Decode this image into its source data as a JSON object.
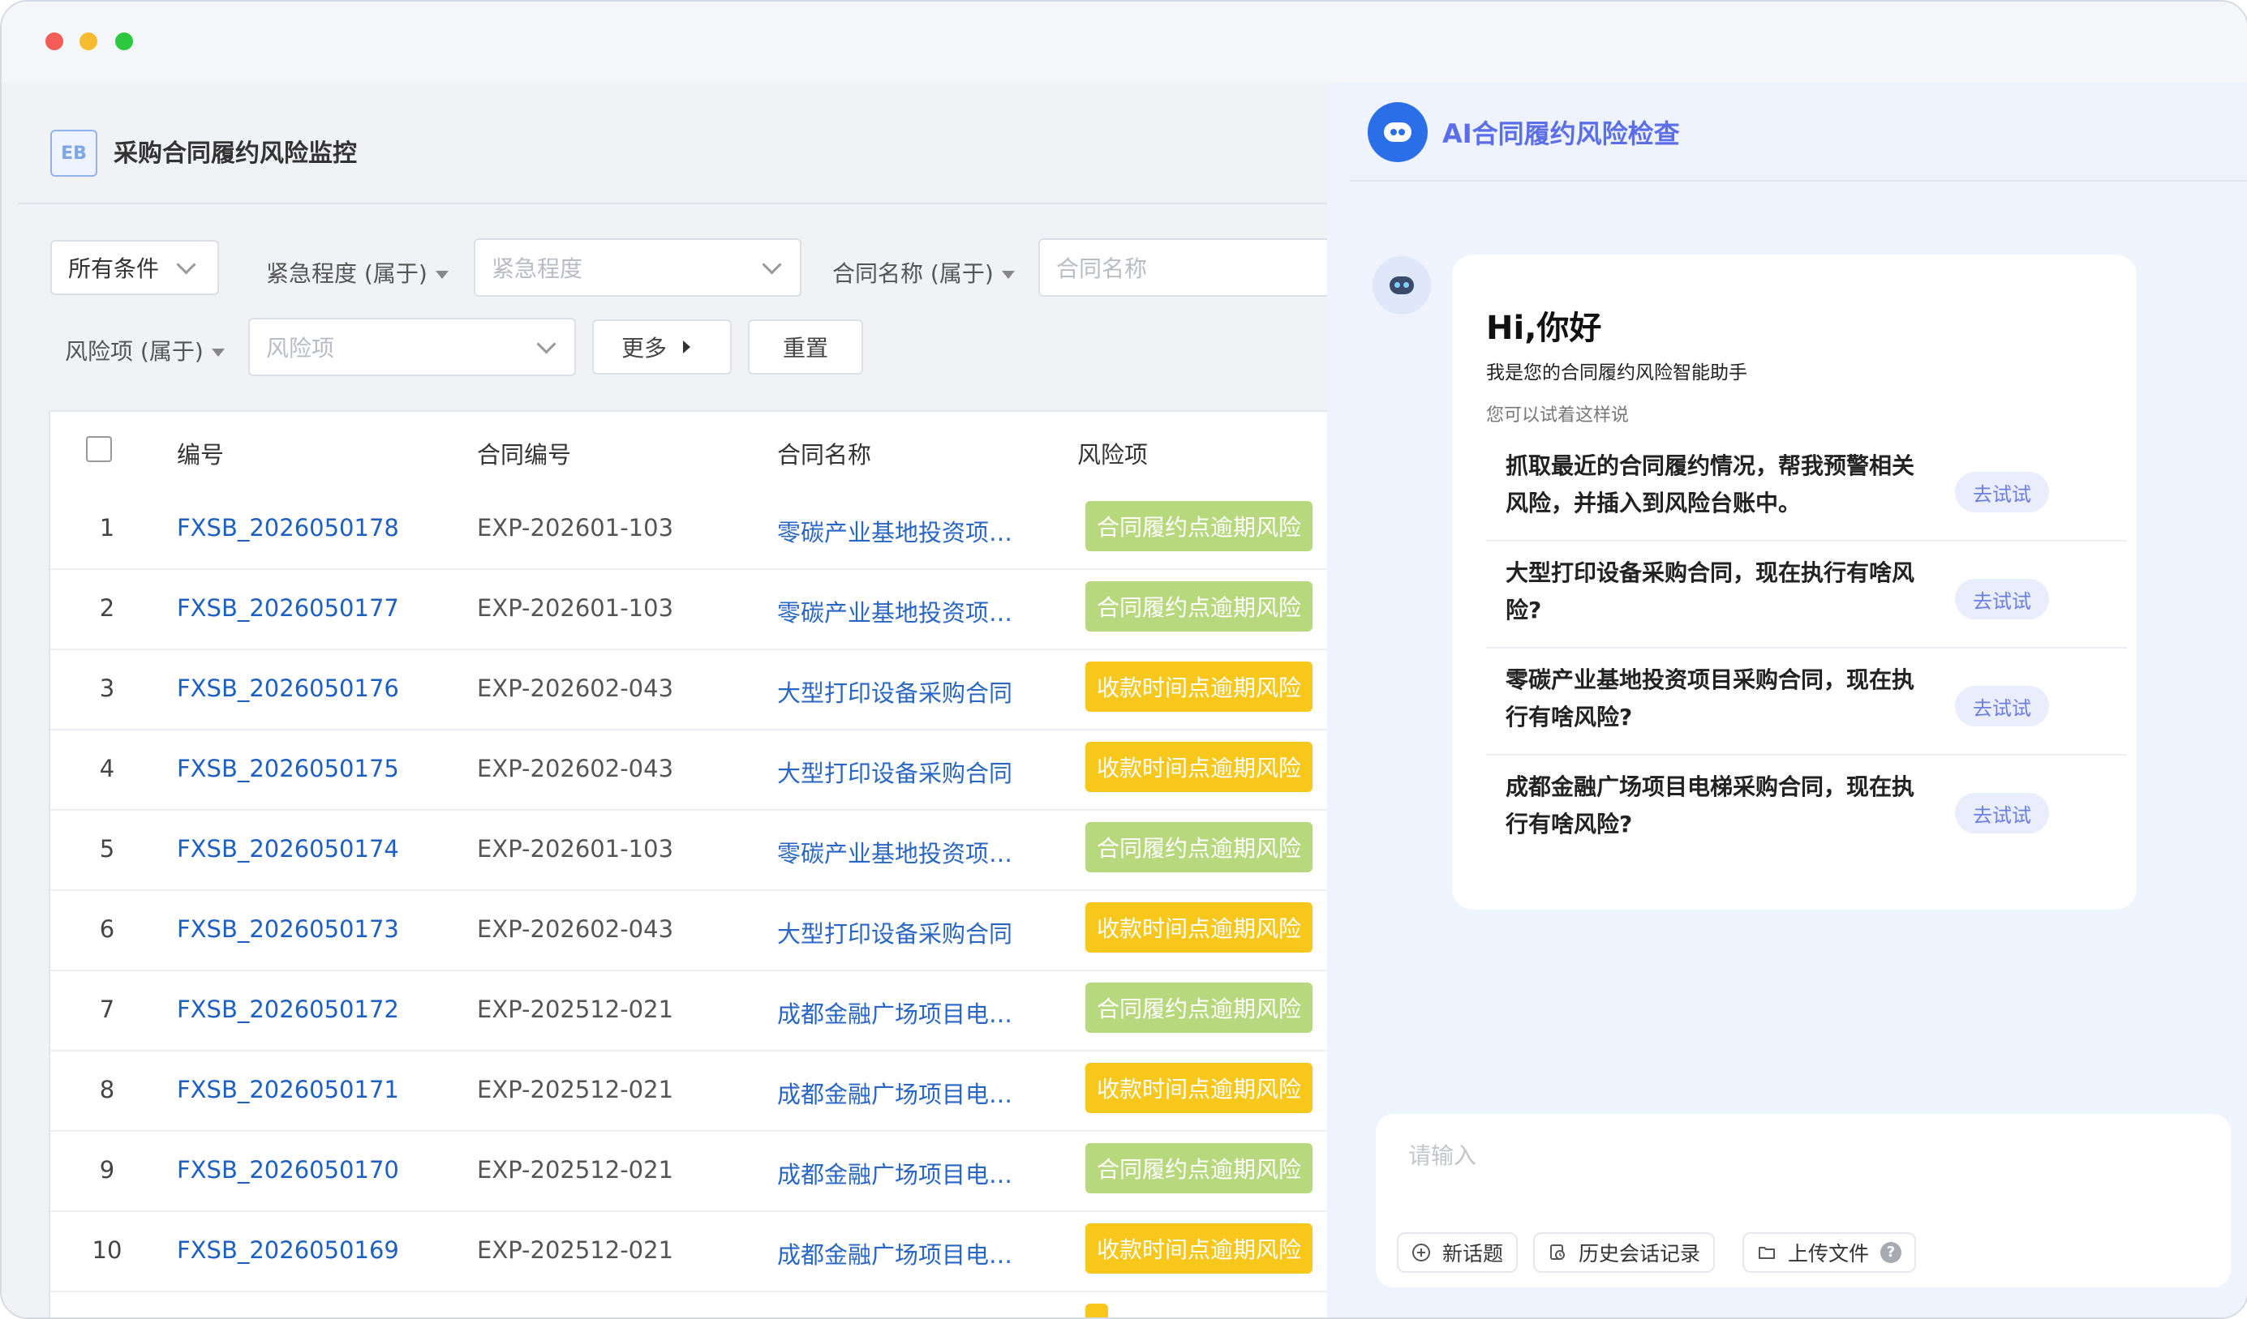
{
  "app": {
    "logo_text": "EB",
    "title": "采购合同履约风险监控"
  },
  "filters": {
    "all_conditions": "所有条件",
    "urgency_label": "紧急程度 (属于)",
    "urgency_placeholder": "紧急程度",
    "contract_name_label": "合同名称 (属于)",
    "contract_name_placeholder": "合同名称",
    "risk_label": "风险项 (属于)",
    "risk_placeholder": "风险项",
    "more_button": "更多",
    "reset_button": "重置"
  },
  "table": {
    "columns": [
      "编号",
      "合同编号",
      "合同名称",
      "风险项"
    ],
    "rows": [
      {
        "idx": "1",
        "no": "FXSB_2026050178",
        "contract_no": "EXP-202601-103",
        "name": "零碳产业基地投资项…",
        "risk": "合同履约点逾期风险",
        "risk_color": "#b8d87e"
      },
      {
        "idx": "2",
        "no": "FXSB_2026050177",
        "contract_no": "EXP-202601-103",
        "name": "零碳产业基地投资项…",
        "risk": "合同履约点逾期风险",
        "risk_color": "#b8d87e"
      },
      {
        "idx": "3",
        "no": "FXSB_2026050176",
        "contract_no": "EXP-202602-043",
        "name": "大型打印设备采购合同",
        "risk": "收款时间点逾期风险",
        "risk_color": "#f7c71b"
      },
      {
        "idx": "4",
        "no": "FXSB_2026050175",
        "contract_no": "EXP-202602-043",
        "name": "大型打印设备采购合同",
        "risk": "收款时间点逾期风险",
        "risk_color": "#f7c71b"
      },
      {
        "idx": "5",
        "no": "FXSB_2026050174",
        "contract_no": "EXP-202601-103",
        "name": "零碳产业基地投资项…",
        "risk": "合同履约点逾期风险",
        "risk_color": "#b8d87e"
      },
      {
        "idx": "6",
        "no": "FXSB_2026050173",
        "contract_no": "EXP-202602-043",
        "name": "大型打印设备采购合同",
        "risk": "收款时间点逾期风险",
        "risk_color": "#f7c71b"
      },
      {
        "idx": "7",
        "no": "FXSB_2026050172",
        "contract_no": "EXP-202512-021",
        "name": "成都金融广场项目电…",
        "risk": "合同履约点逾期风险",
        "risk_color": "#b8d87e"
      },
      {
        "idx": "8",
        "no": "FXSB_2026050171",
        "contract_no": "EXP-202512-021",
        "name": "成都金融广场项目电…",
        "risk": "收款时间点逾期风险",
        "risk_color": "#f7c71b"
      },
      {
        "idx": "9",
        "no": "FXSB_2026050170",
        "contract_no": "EXP-202512-021",
        "name": "成都金融广场项目电…",
        "risk": "合同履约点逾期风险",
        "risk_color": "#b8d87e"
      },
      {
        "idx": "10",
        "no": "FXSB_2026050169",
        "contract_no": "EXP-202512-021",
        "name": "成都金融广场项目电…",
        "risk": "收款时间点逾期风险",
        "risk_color": "#f7c71b"
      }
    ]
  },
  "assistant": {
    "title": "AI合同履约风险检查",
    "greeting": "Hi,你好",
    "intro": "我是您的合同履约风险智能助手",
    "hint": "您可以试着这样说",
    "try_label": "去试试",
    "suggestions": [
      "抓取最近的合同履约情况，帮我预警相关风险，并插入到风险台账中。",
      "大型打印设备采购合同，现在执行有啥风险?",
      "零碳产业基地投资项目采购合同，现在执行有啥风险?",
      "成都金融广场项目电梯采购合同，现在执行有啥风险?"
    ],
    "input_placeholder": "请输入",
    "new_topic": "新话题",
    "history": "历史会话记录",
    "upload": "上传文件",
    "help_mark": "?"
  }
}
